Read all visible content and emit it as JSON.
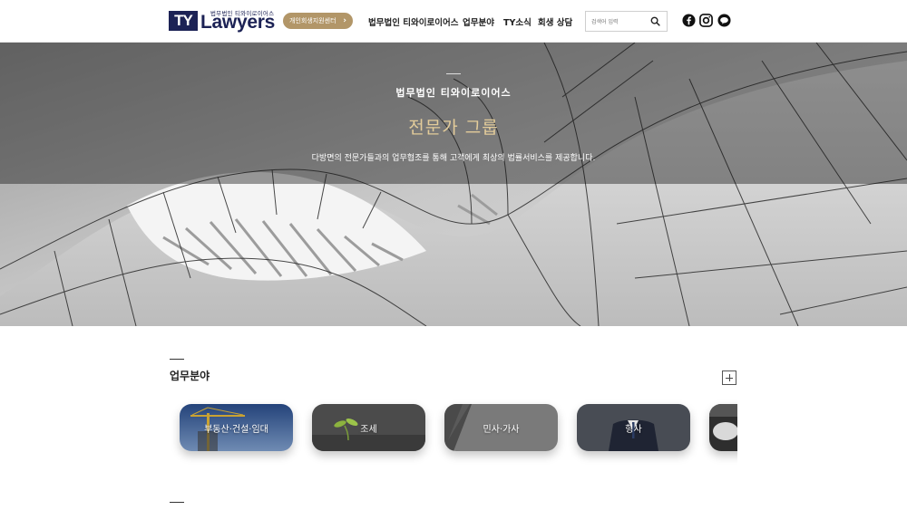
{
  "header": {
    "logo_mark": "TY",
    "logo_subtitle": "법무법인 티와이로이어스",
    "logo_name": "Lawyers",
    "rehab_button": "개인회생지원센터",
    "nav": [
      "법무법인 티와이로이어스",
      "업무분야",
      "TY소식",
      "회생 상담"
    ],
    "search_placeholder": "검색어 입력",
    "sns_icons": [
      "facebook-icon",
      "instagram-icon",
      "kakaotalk-icon"
    ]
  },
  "hero": {
    "kicker": "법무법인 티와이로이어스",
    "title": "전문가 그룹",
    "description": "다방면의 전문가들과의 업무협조를 통해 고객에게 최상의 법률서비스를 제공합니다."
  },
  "practice": {
    "title": "업무분야",
    "cards": [
      {
        "label": "부동산·건설·임대"
      },
      {
        "label": "조세"
      },
      {
        "label": "민사·가사"
      },
      {
        "label": "형사"
      },
      {
        "label": ""
      }
    ]
  },
  "colors": {
    "brand_navy": "#1c2255",
    "accent_gold": "#b29668",
    "hero_title": "#e3cc9a"
  }
}
